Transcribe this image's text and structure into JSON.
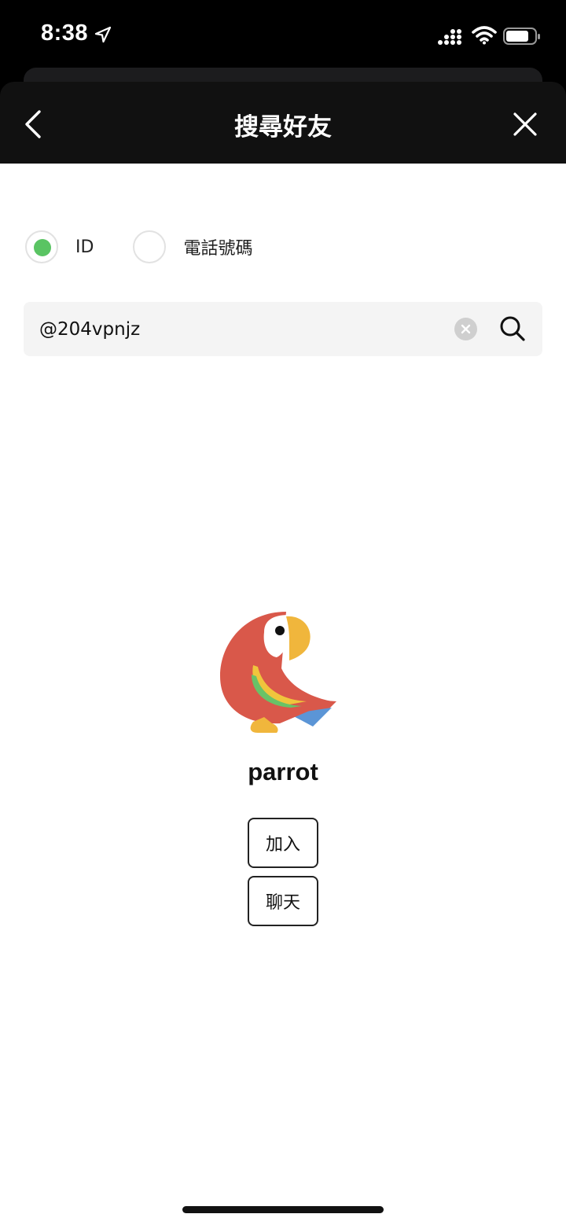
{
  "status_bar": {
    "time": "8:38"
  },
  "header": {
    "title": "搜尋好友"
  },
  "search_type": {
    "options": [
      {
        "label": "ID",
        "selected": true
      },
      {
        "label": "電話號碼",
        "selected": false
      }
    ],
    "selected_color": "#5ac463"
  },
  "search": {
    "value": "@204vpnjz"
  },
  "result": {
    "name": "parrot",
    "add_label": "加入",
    "chat_label": "聊天"
  }
}
